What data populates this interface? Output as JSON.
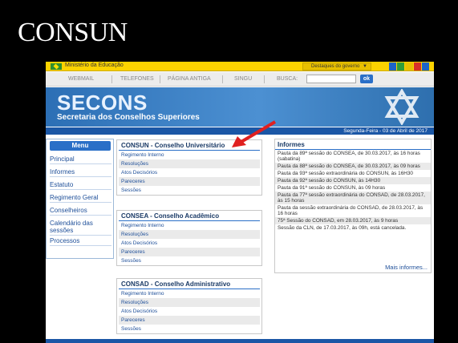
{
  "slide": {
    "title": "CONSUN"
  },
  "govbar": {
    "label": "Ministério da Educação",
    "select_label": "Destaques do governo"
  },
  "nav": {
    "items": [
      "WEBMAIL",
      "TELEFONES",
      "PÁGINA ANTIGA",
      "SINGU",
      "BUSCA:"
    ],
    "ok": "ok"
  },
  "header": {
    "title": "SECONS",
    "subtitle": "Secretaria dos Conselhos Superiores"
  },
  "date": "Segunda-Feira - 03 de Abril de 2017",
  "sidebar": {
    "title": "Menu",
    "items": [
      "Principal",
      "Informes",
      "Estatuto",
      "Regimento Geral",
      "Conselheiros",
      "Calendário das sessões",
      "Processos"
    ]
  },
  "panels": [
    {
      "title": "CONSUN - Conselho Universitário",
      "rows": [
        "Regimento Interno",
        "Resoluções",
        "Atos Decisórios",
        "Pareceres",
        "Sessões"
      ]
    },
    {
      "title": "CONSEA - Conselho Acadêmico",
      "rows": [
        "Regimento Interno",
        "Resoluções",
        "Atos Decisórios",
        "Pareceres",
        "Sessões"
      ]
    },
    {
      "title": "CONSAD - Conselho Administrativo",
      "rows": [
        "Regimento Interno",
        "Resoluções",
        "Atos Decisórios",
        "Pareceres",
        "Sessões"
      ]
    }
  ],
  "informes": {
    "title": "Informes",
    "items": [
      "Pauta da 89ª sessão do CONSEA, de 30.03.2017, às 16 horas (sabatina)",
      "Pauta da 88ª sessão do CONSEA, de 30.03.2017, às 09 horas",
      "Pauta da 93ª sessão extraordinária do CONSUN, às 16H30",
      "Pauta da 92ª sessão do CONSUN, às 14H30",
      "Pauta da 91ª sessão do CONSUN, às 09 horas",
      "Pauta da 77ª sessão extraordinária do CONSAD, de 28.03.2017, às 15 horas",
      "Pauta da sessão extraordinária do CONSAD, de 28.03.2017, às 16 horas",
      "75ª Sessão do CONSAD, em 28.03.2017, às 9 horas",
      "Sessão da CLN, de 17.03.2017, às 09h, está cancelada."
    ],
    "more": "Mais informes..."
  },
  "colors": {
    "accent": "#2a6fc7",
    "govbar": "#fcd300",
    "arrow": "#e02020"
  }
}
